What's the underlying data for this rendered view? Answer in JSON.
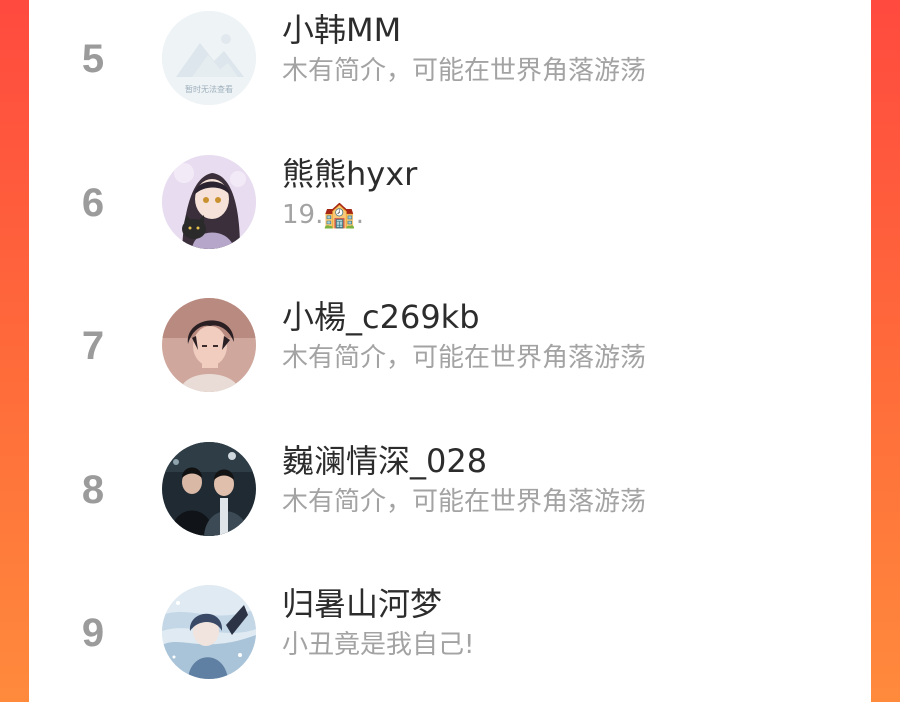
{
  "colors": {
    "accent_left": "#ff4a3f",
    "accent_right": "#ff8a3c",
    "rank": "#9b9b9b",
    "name": "#2c2c2c",
    "bio": "#a3a3a3"
  },
  "rows": [
    {
      "rank": "5",
      "name": "小韩MM",
      "bio": "木有简介，可能在世界角落游荡",
      "avatar_icon": "image-unavailable-placeholder-icon",
      "avatar_text": "暂时无法查看"
    },
    {
      "rank": "6",
      "name": "熊熊hyxr",
      "bio": "19.🏫.",
      "avatar_icon": "anime-girl-with-cat-avatar"
    },
    {
      "rank": "7",
      "name": "小楊_c269kb",
      "bio": "木有简介，可能在世界角落游荡",
      "avatar_icon": "anime-boy-avatar"
    },
    {
      "rank": "8",
      "name": "巍澜情深_028",
      "bio": "木有简介，可能在世界角落游荡",
      "avatar_icon": "two-men-photo-avatar"
    },
    {
      "rank": "9",
      "name": "归暑山河梦",
      "bio": "小丑竟是我自己!",
      "avatar_icon": "anime-blue-artwork-avatar"
    }
  ]
}
